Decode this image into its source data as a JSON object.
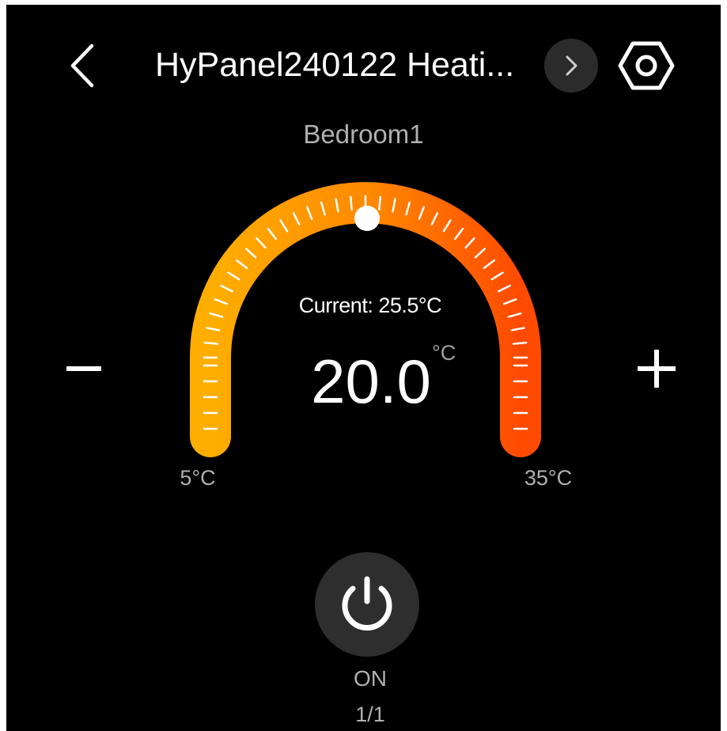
{
  "header": {
    "title": "HyPanel240122 Heati...",
    "back_icon": "chevron-left-icon",
    "next_icon": "chevron-right-icon",
    "settings_icon": "hexagon-settings-icon"
  },
  "room": "Bedroom1",
  "thermostat": {
    "current_label": "Current: 25.5°C",
    "setpoint": "20.0",
    "unit": "°C",
    "min_label": "5°C",
    "max_label": "35°C",
    "min_value": 5,
    "max_value": 35,
    "setpoint_value": 20.0,
    "minus_icon": "minus-icon",
    "plus_icon": "plus-icon",
    "arc_colors": [
      "#ffae00",
      "#ff4a00"
    ]
  },
  "power": {
    "icon": "power-icon",
    "state": "ON"
  },
  "pager": "1/1"
}
